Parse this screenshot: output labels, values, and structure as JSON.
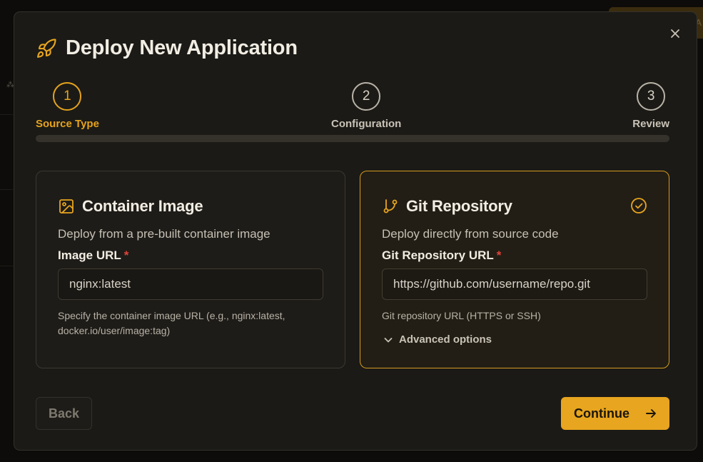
{
  "background": {
    "badge_text": "A"
  },
  "dialog": {
    "title": "Deploy New Application",
    "title_icon": "rocket-icon",
    "close_icon": "close-icon",
    "accent_color": "#e8a51f"
  },
  "stepper": {
    "steps": [
      {
        "number": "1",
        "label": "Source Type",
        "state": "active"
      },
      {
        "number": "2",
        "label": "Configuration",
        "state": "inactive"
      },
      {
        "number": "3",
        "label": "Review",
        "state": "inactive"
      }
    ],
    "progress": 0
  },
  "sources": [
    {
      "title": "Container Image",
      "icon": "image-icon",
      "description": "Deploy from a pre-built container image",
      "field_label": "Image URL",
      "required_marker": "*",
      "value": "nginx:latest",
      "help": "Specify the container image URL (e.g., nginx:latest, docker.io/user/image:tag)",
      "selected": false
    },
    {
      "title": "Git Repository",
      "icon": "git-branch-icon",
      "description": "Deploy directly from source code",
      "field_label": "Git Repository URL",
      "required_marker": "*",
      "value": "https://github.com/username/repo.git",
      "help": "Git repository URL (HTTPS or SSH)",
      "advanced_label": "Advanced options",
      "selected": true,
      "selected_icon": "check-circle-icon"
    }
  ],
  "footer": {
    "back_label": "Back",
    "continue_label": "Continue",
    "continue_icon": "arrow-right-icon"
  }
}
